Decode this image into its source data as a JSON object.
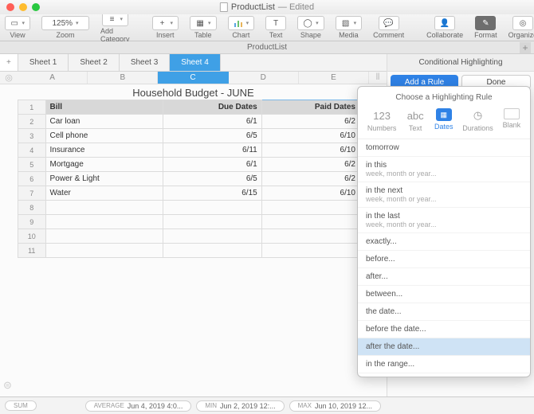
{
  "window": {
    "title": "ProductList",
    "edited": "— Edited",
    "docbar": "ProductList"
  },
  "toolbar": {
    "view": "View",
    "zoom_value": "125%",
    "zoom": "Zoom",
    "addcat": "Add Category",
    "insert": "Insert",
    "table": "Table",
    "chart": "Chart",
    "text": "Text",
    "shape": "Shape",
    "media": "Media",
    "comment": "Comment",
    "collaborate": "Collaborate",
    "format": "Format",
    "organize": "Organize"
  },
  "sheets": {
    "tabs": [
      "Sheet 1",
      "Sheet 2",
      "Sheet 3",
      "Sheet 4"
    ],
    "active": 3,
    "cols": [
      "A",
      "B",
      "C",
      "D",
      "E"
    ],
    "selected_col": 2,
    "title": "Household Budget - JUNE",
    "headers": [
      "Bill",
      "Due Dates",
      "Paid Dates"
    ],
    "rows": [
      {
        "n": "2",
        "a": "Car loan",
        "b": "6/1",
        "c": "6/2"
      },
      {
        "n": "3",
        "a": "Cell phone",
        "b": "6/5",
        "c": "6/10"
      },
      {
        "n": "4",
        "a": "Insurance",
        "b": "6/11",
        "c": "6/10"
      },
      {
        "n": "5",
        "a": "Mortgage",
        "b": "6/1",
        "c": "6/2"
      },
      {
        "n": "6",
        "a": "Power & Light",
        "b": "6/5",
        "c": "6/2"
      },
      {
        "n": "7",
        "a": "Water",
        "b": "6/15",
        "c": "6/10"
      },
      {
        "n": "8",
        "a": "",
        "b": "",
        "c": ""
      },
      {
        "n": "9",
        "a": "",
        "b": "",
        "c": ""
      },
      {
        "n": "10",
        "a": "",
        "b": "",
        "c": ""
      },
      {
        "n": "11",
        "a": "",
        "b": "",
        "c": ""
      }
    ]
  },
  "inspector": {
    "title": "Conditional Highlighting",
    "add": "Add a Rule",
    "done": "Done"
  },
  "popover": {
    "title": "Choose a Highlighting Rule",
    "tabs": [
      {
        "label": "Numbers",
        "glyph": "123"
      },
      {
        "label": "Text",
        "glyph": "abc"
      },
      {
        "label": "Dates",
        "glyph": "▦"
      },
      {
        "label": "Durations",
        "glyph": "◷"
      },
      {
        "label": "Blank",
        "glyph": ""
      }
    ],
    "active_tab": 2,
    "rules": [
      {
        "t": "tomorrow"
      },
      {
        "t": "in this",
        "s": "week, month or year..."
      },
      {
        "t": "in the next",
        "s": "week, month or year..."
      },
      {
        "t": "in the last",
        "s": "week, month or year..."
      },
      {
        "t": "exactly..."
      },
      {
        "t": "before..."
      },
      {
        "t": "after..."
      },
      {
        "t": "between..."
      },
      {
        "t": "the date..."
      },
      {
        "t": "before the date..."
      },
      {
        "t": "after the date...",
        "hl": true
      },
      {
        "t": "in the range..."
      }
    ]
  },
  "statusbar": {
    "sum": "SUM",
    "avg_k": "AVERAGE",
    "avg_v": "Jun 4, 2019 4:0...",
    "min_k": "MIN",
    "min_v": "Jun 2, 2019 12:...",
    "max_k": "MAX",
    "max_v": "Jun 10, 2019 12..."
  }
}
